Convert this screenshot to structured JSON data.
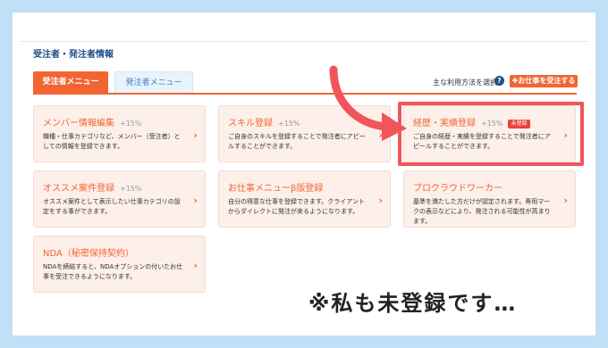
{
  "section_title": "受注者・発注者情報",
  "tabs": [
    {
      "label": "受注者メニュー",
      "active": true
    },
    {
      "label": "発注者メニュー",
      "active": false
    }
  ],
  "help": {
    "label": "主な利用方法を選択",
    "icon": "question-icon"
  },
  "accept_button": {
    "label": "✚お仕事を受注する"
  },
  "cards": [
    {
      "title": "メンバー情報編集",
      "pct": "+15%",
      "desc": "職種・仕事カテゴリなど、メンバー（受注者）としての情報を登録できます。"
    },
    {
      "title": "スキル登録",
      "pct": "+15%",
      "desc": "ご自身のスキルを登録することで発注者にアピールすることができます。"
    },
    {
      "title": "経歴・実績登録",
      "pct": "+15%",
      "badge": "未登録",
      "desc": "ご自身の経歴・実績を登録することで発注者にアピールすることができます。"
    },
    {
      "title": "オススメ案件登録",
      "pct": "+15%",
      "desc": "オススメ案件として表示したい仕事カテゴリの設定をする事ができます。"
    },
    {
      "title": "お仕事メニューβ版登録",
      "pct": "",
      "desc": "自分の得意な仕事を登録できます。クライアントからダイレクトに発注が来るようになります。"
    },
    {
      "title": "プロクラウドワーカー",
      "pct": "",
      "desc": "基準を満たした方だけが認定されます。専用マークの表示などにより、発注される可能性が高まります。"
    },
    {
      "title": "NDA（秘密保持契約）",
      "pct": "",
      "desc": "NDAを締結すると、NDAオプションの付いたお仕事を受注できるようになります。"
    }
  ],
  "caption": "※私も未登録です…",
  "colors": {
    "accent": "#f26532",
    "highlight": "#f2545b",
    "background": "#bfe0f7"
  }
}
